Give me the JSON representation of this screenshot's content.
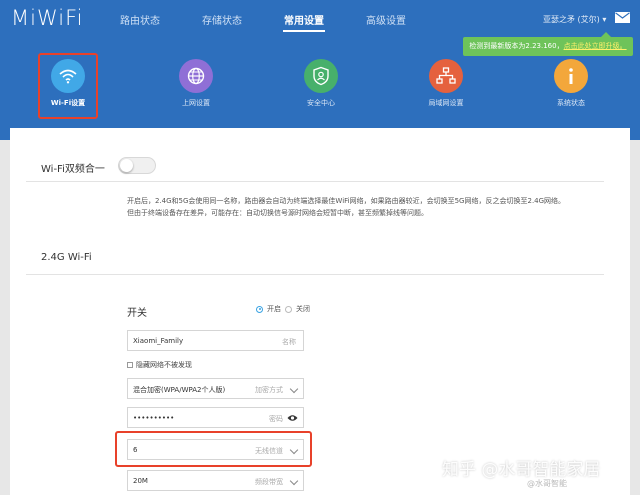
{
  "app": {
    "logo": "MiWiFi"
  },
  "nav": {
    "items": [
      {
        "label": "路由状态"
      },
      {
        "label": "存储状态"
      },
      {
        "label": "常用设置"
      },
      {
        "label": "高级设置"
      }
    ],
    "active_index": 2
  },
  "user": {
    "name": "亚瑟之矛 (艾尔) ▾"
  },
  "update_banner": {
    "text": "检测到最新版本为2.23.160，",
    "link": "点击此处立即升级。"
  },
  "tabs": [
    {
      "label": "Wi-Fi设置",
      "icon": "wifi-icon",
      "color": "#41a8e7"
    },
    {
      "label": "上网设置",
      "icon": "globe-icon",
      "color": "#8f6fd6"
    },
    {
      "label": "安全中心",
      "icon": "shield-icon",
      "color": "#47b06b"
    },
    {
      "label": "局域网设置",
      "icon": "network-icon",
      "color": "#e5613e"
    },
    {
      "label": "系统状态",
      "icon": "info-icon",
      "color": "#f3a73b"
    }
  ],
  "dual_band": {
    "label": "Wi-Fi双频合一",
    "enabled": false
  },
  "description": {
    "line1": "开启后，2.4G和5G会使用同一名称，路由器会自动为终端选择最佳WiFi网络，如果路由器较近，会切换至5G网络，反之会切换至2.4G网络。",
    "line2": "但由于终端设备存在差异，可能存在：自动切换信号源时网络会短暂中断，甚至频繁掉线等问题。"
  },
  "section_24g": {
    "title": "2.4G Wi-Fi",
    "switch_label": "开关",
    "radio_on": "开启",
    "radio_off": "关闭",
    "ssid": {
      "value": "Xiaomi_Family",
      "hint": "名称"
    },
    "hide_network": "隐藏网络不被发现",
    "encryption": {
      "value": "混合加密(WPA/WPA2个人版)",
      "hint": "加密方式"
    },
    "password": {
      "value": "••••••••••",
      "hint": "密码"
    },
    "channel": {
      "value": "6",
      "hint": "无线信道"
    },
    "bandwidth": {
      "value": "20M",
      "hint": "频段带宽"
    }
  },
  "watermark": {
    "text": "知乎 @水哥智能家居",
    "sub": "@水哥智能"
  }
}
